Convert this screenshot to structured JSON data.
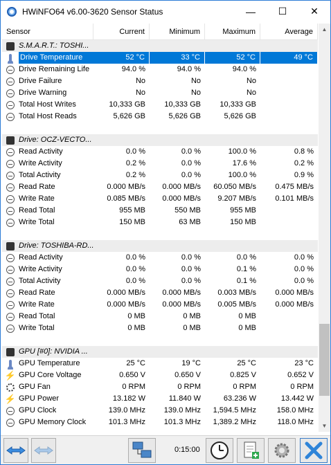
{
  "window": {
    "title": "HWiNFO64 v6.00-3620 Sensor Status"
  },
  "title_controls": {
    "minimize": "—",
    "maximize": "☐",
    "close": "✕"
  },
  "columns": [
    "Sensor",
    "Current",
    "Minimum",
    "Maximum",
    "Average"
  ],
  "rows": [
    {
      "type": "group",
      "icon": "drive-icon",
      "label": "S.M.A.R.T.: TOSHI..."
    },
    {
      "type": "row",
      "icon": "thermometer-icon",
      "label": "Drive Temperature",
      "cur": "52 °C",
      "min": "33 °C",
      "max": "52 °C",
      "avg": "49 °C",
      "selected": true
    },
    {
      "type": "row",
      "icon": "clock-icon",
      "label": "Drive Remaining Life",
      "cur": "94.0 %",
      "min": "94.0 %",
      "max": "94.0 %",
      "avg": ""
    },
    {
      "type": "row",
      "icon": "clock-icon",
      "label": "Drive Failure",
      "cur": "No",
      "min": "No",
      "max": "No",
      "avg": ""
    },
    {
      "type": "row",
      "icon": "clock-icon",
      "label": "Drive Warning",
      "cur": "No",
      "min": "No",
      "max": "No",
      "avg": ""
    },
    {
      "type": "row",
      "icon": "clock-icon",
      "label": "Total Host Writes",
      "cur": "10,333 GB",
      "min": "10,333 GB",
      "max": "10,333 GB",
      "avg": ""
    },
    {
      "type": "row",
      "icon": "clock-icon",
      "label": "Total Host Reads",
      "cur": "5,626 GB",
      "min": "5,626 GB",
      "max": "5,626 GB",
      "avg": ""
    },
    {
      "type": "blank"
    },
    {
      "type": "group",
      "icon": "drive-icon",
      "label": "Drive: OCZ-VECTO..."
    },
    {
      "type": "row",
      "icon": "clock-icon",
      "label": "Read Activity",
      "cur": "0.0 %",
      "min": "0.0 %",
      "max": "100.0 %",
      "avg": "0.8 %"
    },
    {
      "type": "row",
      "icon": "clock-icon",
      "label": "Write Activity",
      "cur": "0.2 %",
      "min": "0.0 %",
      "max": "17.6 %",
      "avg": "0.2 %"
    },
    {
      "type": "row",
      "icon": "clock-icon",
      "label": "Total Activity",
      "cur": "0.2 %",
      "min": "0.0 %",
      "max": "100.0 %",
      "avg": "0.9 %"
    },
    {
      "type": "row",
      "icon": "clock-icon",
      "label": "Read Rate",
      "cur": "0.000 MB/s",
      "min": "0.000 MB/s",
      "max": "60.050 MB/s",
      "avg": "0.475 MB/s"
    },
    {
      "type": "row",
      "icon": "clock-icon",
      "label": "Write Rate",
      "cur": "0.085 MB/s",
      "min": "0.000 MB/s",
      "max": "9.207 MB/s",
      "avg": "0.101 MB/s"
    },
    {
      "type": "row",
      "icon": "clock-icon",
      "label": "Read Total",
      "cur": "955 MB",
      "min": "550 MB",
      "max": "955 MB",
      "avg": ""
    },
    {
      "type": "row",
      "icon": "clock-icon",
      "label": "Write Total",
      "cur": "150 MB",
      "min": "63 MB",
      "max": "150 MB",
      "avg": ""
    },
    {
      "type": "blank"
    },
    {
      "type": "group",
      "icon": "drive-icon",
      "label": "Drive: TOSHIBA-RD..."
    },
    {
      "type": "row",
      "icon": "clock-icon",
      "label": "Read Activity",
      "cur": "0.0 %",
      "min": "0.0 %",
      "max": "0.0 %",
      "avg": "0.0 %"
    },
    {
      "type": "row",
      "icon": "clock-icon",
      "label": "Write Activity",
      "cur": "0.0 %",
      "min": "0.0 %",
      "max": "0.1 %",
      "avg": "0.0 %"
    },
    {
      "type": "row",
      "icon": "clock-icon",
      "label": "Total Activity",
      "cur": "0.0 %",
      "min": "0.0 %",
      "max": "0.1 %",
      "avg": "0.0 %"
    },
    {
      "type": "row",
      "icon": "clock-icon",
      "label": "Read Rate",
      "cur": "0.000 MB/s",
      "min": "0.000 MB/s",
      "max": "0.003 MB/s",
      "avg": "0.000 MB/s"
    },
    {
      "type": "row",
      "icon": "clock-icon",
      "label": "Write Rate",
      "cur": "0.000 MB/s",
      "min": "0.000 MB/s",
      "max": "0.005 MB/s",
      "avg": "0.000 MB/s"
    },
    {
      "type": "row",
      "icon": "clock-icon",
      "label": "Read Total",
      "cur": "0 MB",
      "min": "0 MB",
      "max": "0 MB",
      "avg": ""
    },
    {
      "type": "row",
      "icon": "clock-icon",
      "label": "Write Total",
      "cur": "0 MB",
      "min": "0 MB",
      "max": "0 MB",
      "avg": ""
    },
    {
      "type": "blank"
    },
    {
      "type": "group",
      "icon": "chip-icon",
      "label": "GPU [#0]: NVIDIA ..."
    },
    {
      "type": "row",
      "icon": "thermometer-icon",
      "label": "GPU Temperature",
      "cur": "25 °C",
      "min": "19 °C",
      "max": "25 °C",
      "avg": "23 °C"
    },
    {
      "type": "row",
      "icon": "bolt-icon",
      "label": "GPU Core Voltage",
      "cur": "0.650 V",
      "min": "0.650 V",
      "max": "0.825 V",
      "avg": "0.652 V"
    },
    {
      "type": "row",
      "icon": "fan-icon",
      "label": "GPU Fan",
      "cur": "0 RPM",
      "min": "0 RPM",
      "max": "0 RPM",
      "avg": "0 RPM"
    },
    {
      "type": "row",
      "icon": "bolt-icon",
      "label": "GPU Power",
      "cur": "13.182 W",
      "min": "11.840 W",
      "max": "63.236 W",
      "avg": "13.442 W"
    },
    {
      "type": "row",
      "icon": "clock-icon",
      "label": "GPU Clock",
      "cur": "139.0 MHz",
      "min": "139.0 MHz",
      "max": "1,594.5 MHz",
      "avg": "158.0 MHz"
    },
    {
      "type": "row",
      "icon": "clock-icon",
      "label": "GPU Memory Clock",
      "cur": "101.3 MHz",
      "min": "101.3 MHz",
      "max": "1,389.2 MHz",
      "avg": "118.0 MHz"
    }
  ],
  "toolbar": {
    "timer": "0:15:00"
  },
  "colors": {
    "selection": "#0078d7",
    "group_bg": "#ededed",
    "accent": "#2b7bd6"
  }
}
